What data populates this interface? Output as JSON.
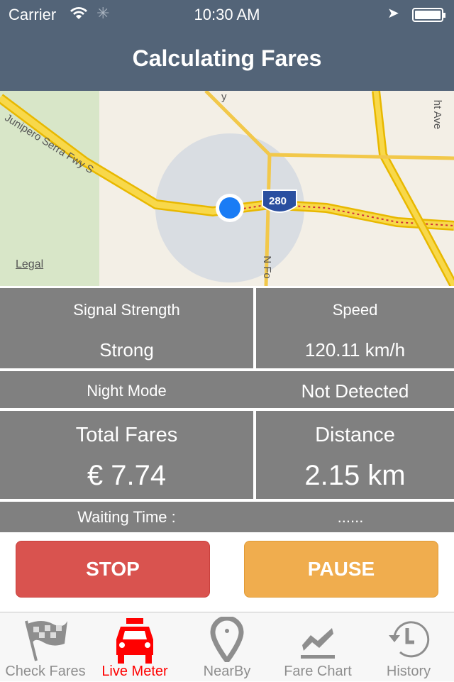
{
  "status_bar": {
    "carrier": "Carrier",
    "time": "10:30 AM",
    "icons": [
      "wifi-icon",
      "activity-spinner-icon",
      "location-arrow-icon",
      "battery-icon"
    ]
  },
  "nav": {
    "title": "Calculating Fares"
  },
  "map": {
    "labels": [
      "Junipero Serra Fwy S",
      "280",
      "N Fo",
      "ht Ave",
      "y"
    ],
    "legal": "Legal"
  },
  "meter": {
    "signal_label": "Signal Strength",
    "signal_value": "Strong",
    "speed_label": "Speed",
    "speed_value": "120.11 km/h",
    "night_label": "Night Mode",
    "night_value": "Not Detected",
    "fares_label": "Total Fares",
    "fares_value": "€ 7.74",
    "distance_label": "Distance",
    "distance_value": "2.15 km",
    "waiting_label": "Waiting Time :",
    "waiting_value": "......"
  },
  "buttons": {
    "stop": "STOP",
    "pause": "PAUSE",
    "stop_color": "#d9534f",
    "pause_color": "#f0ad4e"
  },
  "tabs": [
    {
      "label": "Check Fares",
      "icon": "checkered-flag-icon"
    },
    {
      "label": "Live Meter",
      "icon": "taxi-icon",
      "active": true
    },
    {
      "label": "NearBy",
      "icon": "map-pin-icon"
    },
    {
      "label": "Fare Chart",
      "icon": "chart-icon"
    },
    {
      "label": "History",
      "icon": "history-icon"
    }
  ],
  "colors": {
    "nav": "#536478",
    "cell": "#808080",
    "active_tab": "#ff0000"
  }
}
